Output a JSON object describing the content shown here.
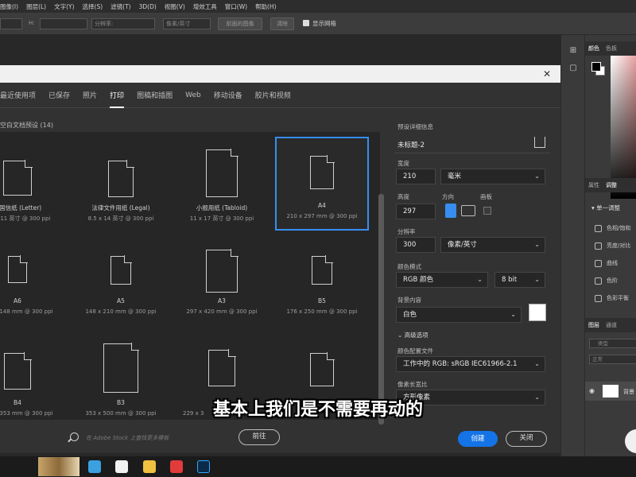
{
  "menubar": {
    "items": [
      "图像(I)",
      "图层(L)",
      "文字(Y)",
      "选择(S)",
      "滤镜(T)",
      "3D(D)",
      "视图(V)",
      "增效工具",
      "窗口(W)",
      "帮助(H)"
    ]
  },
  "options_bar": {
    "w_label": "W:",
    "h_label": "H:",
    "resolution_placeholder": "分辨率:",
    "unit_placeholder": "像素/英寸",
    "front_image_label": "前面的图像",
    "clear_label": "清除",
    "show_grid_label": "显示网格"
  },
  "right_panel": {
    "tabs_top": [
      "颜色",
      "色板"
    ],
    "tabs_mid": [
      "属性",
      "调整"
    ],
    "adjust_title": "单一调整",
    "adjust_items": [
      "色相/饱和",
      "亮度/对比",
      "曲线",
      "色阶",
      "色彩平衡"
    ],
    "layers_tabs": [
      "图层",
      "通道"
    ],
    "layer_search": "类型",
    "layer_mode": "正常",
    "layer_name": "背景"
  },
  "dialog": {
    "tabs": [
      {
        "label": "最近使用项",
        "active": false
      },
      {
        "label": "已保存",
        "active": false
      },
      {
        "label": "照片",
        "active": false
      },
      {
        "label": "打印",
        "active": true
      },
      {
        "label": "图稿和插图",
        "active": false
      },
      {
        "label": "Web",
        "active": false
      },
      {
        "label": "移动设备",
        "active": false
      },
      {
        "label": "胶片和视频",
        "active": false
      }
    ],
    "presets_title": "空白文档预设 (14)",
    "presets": [
      {
        "title": "美国信纸 (Letter)",
        "sub": "8.5 x 11 英寸 @ 300 ppi"
      },
      {
        "title": "法律文件用纸 (Legal)",
        "sub": "8.5 x 14 英寸 @ 300 ppi"
      },
      {
        "title": "小报用纸 (Tabloid)",
        "sub": "11 x 17 英寸 @ 300 ppi"
      },
      {
        "title": "A4",
        "sub": "210 x 297 mm @ 300 ppi",
        "selected": true
      },
      {
        "title": "A6",
        "sub": "105 x 148 mm @ 300 ppi"
      },
      {
        "title": "A5",
        "sub": "148 x 210 mm @ 300 ppi"
      },
      {
        "title": "A3",
        "sub": "297 x 420 mm @ 300 ppi"
      },
      {
        "title": "B5",
        "sub": "176 x 250 mm @ 300 ppi"
      },
      {
        "title": "B4",
        "sub": "250 x 353 mm @ 300 ppi"
      },
      {
        "title": "B3",
        "sub": "353 x 500 mm @ 300 ppi"
      },
      {
        "title": "",
        "sub": "229 x 3"
      },
      {
        "title": "",
        "sub": ""
      }
    ],
    "search_placeholder": "在 Adobe Stock 上查找更多模板",
    "goto_label": "前往",
    "details": {
      "section_title": "预设详细信息",
      "doc_name": "未标题-2",
      "width_label": "宽度",
      "width_value": "210",
      "width_unit": "毫米",
      "height_label": "高度",
      "height_value": "297",
      "orientation_label": "方向",
      "artboard_label": "画板",
      "resolution_label": "分辨率",
      "resolution_value": "300",
      "resolution_unit": "像素/英寸",
      "color_mode_label": "颜色模式",
      "color_mode_value": "RGB 颜色",
      "bit_depth": "8 bit",
      "bg_label": "背景内容",
      "bg_value": "白色",
      "advanced_label": "高级选项",
      "profile_label": "颜色配置文件",
      "profile_value": "工作中的 RGB: sRGB IEC61966-2.1",
      "pixel_aspect_label": "像素长宽比",
      "pixel_aspect_value": "方形像素"
    },
    "create_label": "创建",
    "close_label": "关闭"
  },
  "subtitle": "基本上我们是不需要再动的",
  "colors": {
    "accent": "#378ef0",
    "create_button": "#1473e6",
    "dialog_bg": "#323232",
    "grid_bg": "#262626"
  }
}
